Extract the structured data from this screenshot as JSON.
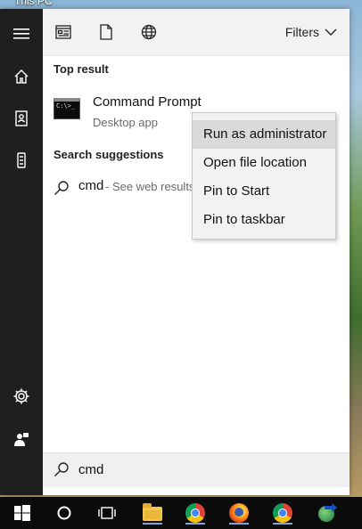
{
  "desktop": {
    "label": "This PC"
  },
  "rail": {
    "items": [
      {
        "name": "hamburger-menu-icon"
      },
      {
        "name": "home-icon"
      },
      {
        "name": "notebook-icon"
      },
      {
        "name": "reminders-icon"
      },
      {
        "name": "settings-gear-icon"
      },
      {
        "name": "feedback-icon"
      }
    ]
  },
  "top_bar": {
    "filters_label": "Filters"
  },
  "sections": {
    "top_result": "Top result",
    "search_suggestions": "Search suggestions"
  },
  "top_result": {
    "title": "Command Prompt",
    "subtitle": "Desktop app",
    "icon_text": "C:\\>_"
  },
  "suggestion": {
    "query": "cmd",
    "hint": "- See web results"
  },
  "search": {
    "value": "cmd"
  },
  "context_menu": {
    "items": [
      {
        "label": "Run as administrator",
        "highlighted": true
      },
      {
        "label": "Open file location"
      },
      {
        "label": "Pin to Start"
      },
      {
        "label": "Pin to taskbar"
      }
    ]
  },
  "taskbar": {
    "items": [
      "start-button",
      "cortana-button",
      "task-view-button",
      "file-explorer-icon",
      "chrome-icon",
      "firefox-icon",
      "chrome-icon-2",
      "idm-icon"
    ]
  },
  "colors": {
    "rail_bg": "#1f1f1f",
    "highlight": "#dadada",
    "taskbar_bg": "#0b0b0b"
  }
}
